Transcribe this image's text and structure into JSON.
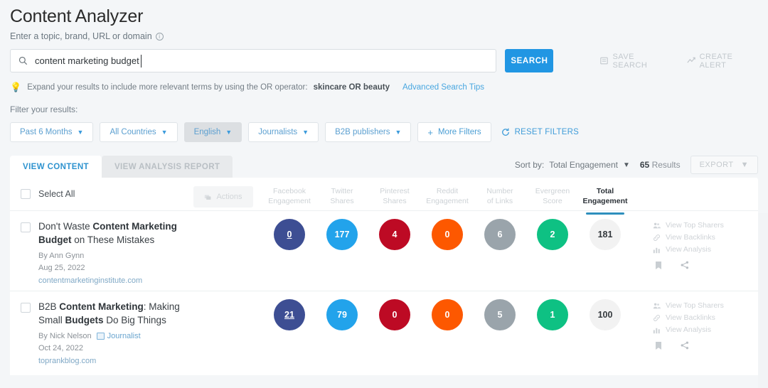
{
  "header": {
    "title": "Content Analyzer",
    "subtitle": "Enter a topic, brand, URL or domain",
    "info_icon": "info-icon"
  },
  "search": {
    "value": "content marketing budget",
    "placeholder": "Enter a topic, brand, URL or domain",
    "button_label": "SEARCH",
    "icon": "search-icon",
    "save_search_label": "SAVE SEARCH",
    "save_search_icon": "save-icon",
    "create_alert_label": "CREATE ALERT",
    "create_alert_icon": "trend-up-icon"
  },
  "tip": {
    "icon": "lightbulb-icon",
    "text": "Expand your results to include more relevant terms by using the OR operator:",
    "example": "skincare OR beauty",
    "link_label": "Advanced Search Tips"
  },
  "filters": {
    "label": "Filter your results:",
    "pills": [
      {
        "label": "Past 6 Months",
        "active": false
      },
      {
        "label": "All Countries",
        "active": false
      },
      {
        "label": "English",
        "active": true
      },
      {
        "label": "Journalists",
        "active": false
      },
      {
        "label": "B2B publishers",
        "active": false
      }
    ],
    "more_filters_label": "More Filters",
    "reset_label": "RESET FILTERS",
    "reset_icon": "refresh-icon"
  },
  "tabs": [
    {
      "label": "VIEW CONTENT",
      "active": true
    },
    {
      "label": "VIEW ANALYSIS REPORT",
      "active": false
    }
  ],
  "toolbar": {
    "sort_prefix": "Sort by:",
    "sort_value": "Total Engagement",
    "results_count": "65",
    "results_label": "Results",
    "export_label": "EXPORT"
  },
  "table": {
    "select_all_label": "Select All",
    "actions_label": "Actions",
    "actions_icon": "layers-icon",
    "columns": [
      {
        "line1": "Facebook",
        "line2": "Engagement",
        "active": false,
        "color": "#3d4e93"
      },
      {
        "line1": "Twitter",
        "line2": "Shares",
        "active": false,
        "color": "#22a3eb"
      },
      {
        "line1": "Pinterest",
        "line2": "Shares",
        "active": false,
        "color": "#bd0a24"
      },
      {
        "line1": "Reddit",
        "line2": "Engagement",
        "active": false,
        "color": "#fd5800"
      },
      {
        "line1": "Number",
        "line2": "of Links",
        "active": false,
        "color": "#9aa4ab"
      },
      {
        "line1": "Evergreen",
        "line2": "Score",
        "active": false,
        "color": "#0ec183"
      },
      {
        "line1": "Total",
        "line2": "Engagement",
        "active": true,
        "color": "#f2f2f2"
      }
    ],
    "rows": [
      {
        "title_parts": [
          {
            "text": "Don't Waste ",
            "bold": false
          },
          {
            "text": "Content Marketing Budget",
            "bold": true
          },
          {
            "text": " on These Mistakes",
            "bold": false
          }
        ],
        "author": "By  Ann Gynn",
        "journalist_badge": "",
        "date": "Aug 25, 2022",
        "domain": "contentmarketinginstitute.com",
        "metrics": [
          0,
          177,
          4,
          0,
          6,
          2
        ],
        "total": 181
      },
      {
        "title_parts": [
          {
            "text": "B2B ",
            "bold": false
          },
          {
            "text": "Content Marketing",
            "bold": true
          },
          {
            "text": ": Making Small ",
            "bold": false
          },
          {
            "text": "Budgets",
            "bold": true
          },
          {
            "text": " Do Big Things",
            "bold": false
          }
        ],
        "author": "By Nick Nelson",
        "journalist_badge": "Journalist",
        "date": "Oct 24, 2022",
        "domain": "toprankblog.com",
        "metrics": [
          21,
          79,
          0,
          0,
          5,
          1
        ],
        "total": 100
      }
    ],
    "row_actions": [
      {
        "label": "View Top Sharers",
        "icon": "people-icon"
      },
      {
        "label": "View Backlinks",
        "icon": "link-icon"
      },
      {
        "label": "View Analysis",
        "icon": "bar-chart-icon"
      }
    ],
    "row_icon_buttons": [
      {
        "icon": "bookmark-icon"
      },
      {
        "icon": "share-icon"
      }
    ]
  },
  "colors": {
    "accent": "#2196e3",
    "link": "#49a7e0",
    "active_tab": "#2e93cf",
    "underline": "#2e8fbd"
  }
}
